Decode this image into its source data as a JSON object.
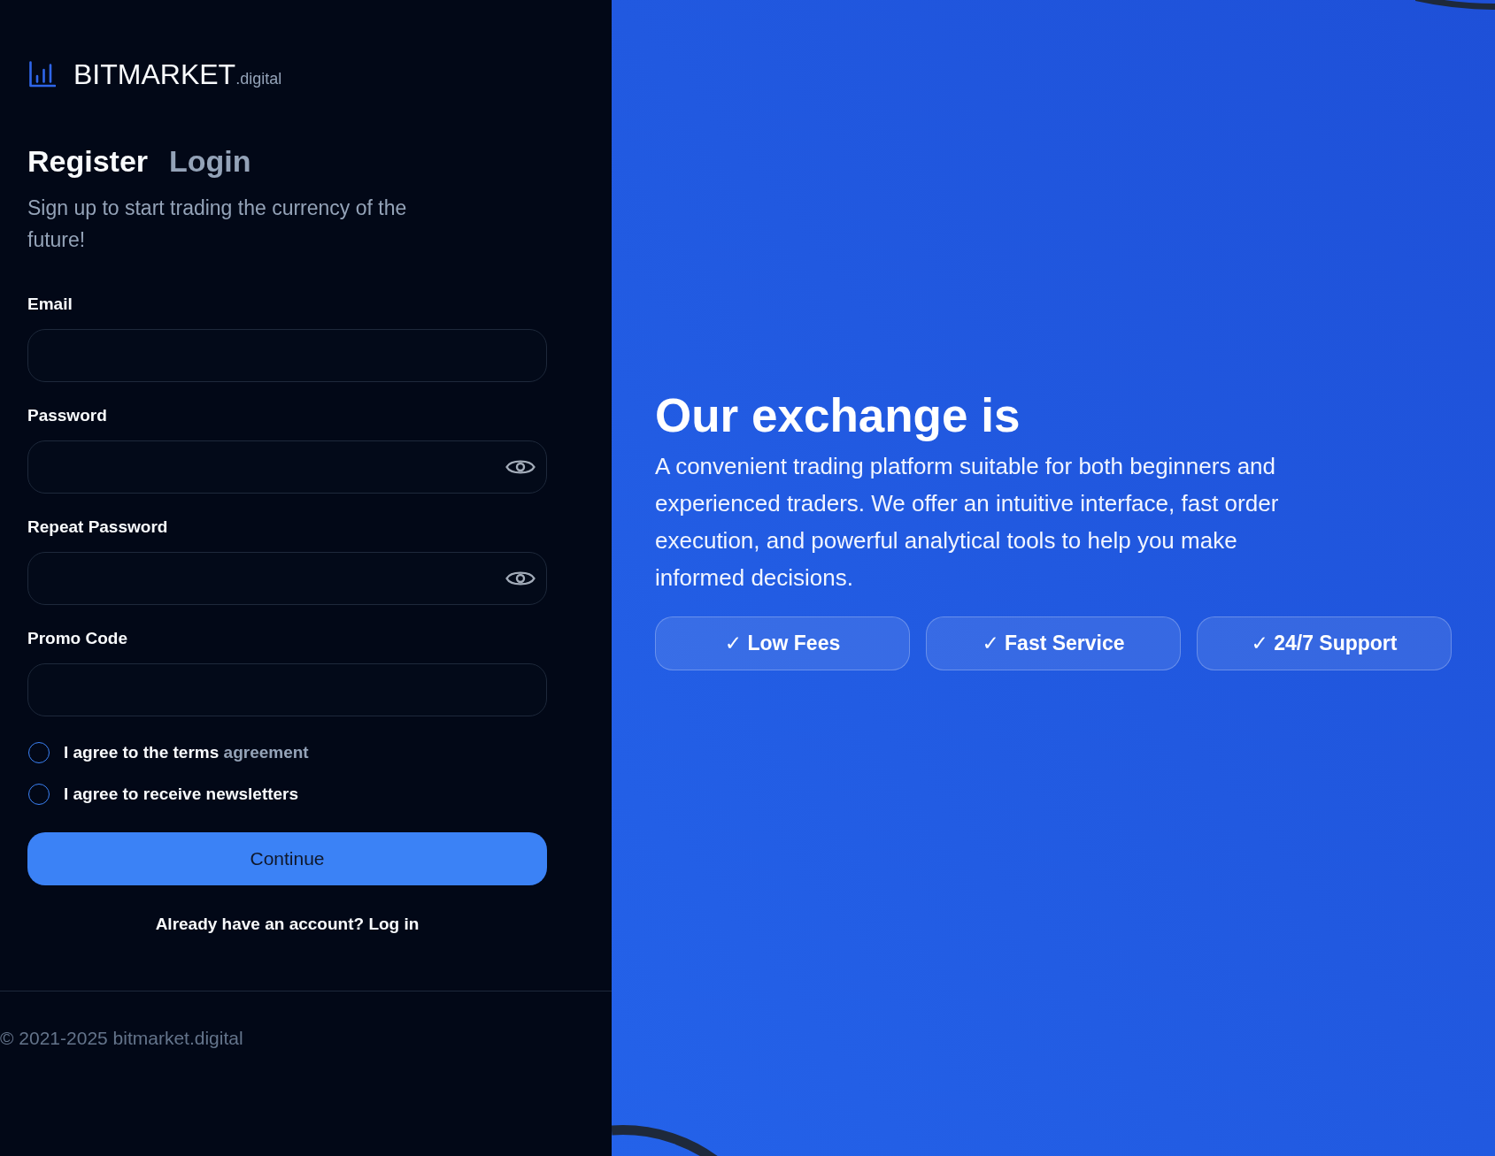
{
  "brand": {
    "name": "BITMARKET",
    "suffix": ".digital"
  },
  "tabs": [
    {
      "label": "Register",
      "selected": true
    },
    {
      "label": "Login",
      "selected": false
    }
  ],
  "subtitle": "Sign up to start trading the currency of the future!",
  "fields": [
    {
      "label": "Email",
      "kind": "text"
    },
    {
      "label": "Password",
      "kind": "password"
    },
    {
      "label": "Repeat Password",
      "kind": "password"
    },
    {
      "label": "Promo Code",
      "kind": "text"
    }
  ],
  "agreements": [
    {
      "label": "I agree to the terms",
      "link": "agreement",
      "checked": false
    },
    {
      "label": "I agree to receive newsletters",
      "checked": false
    }
  ],
  "submit": "Continue",
  "account_prompt": {
    "text": "Already have an account?",
    "link": "Log in"
  },
  "footer": "© 2021-2025 bitmarket.digital",
  "hero": {
    "title": "Our exchange is",
    "description": "A convenient trading platform suitable for both beginners and experienced traders. We offer an intuitive interface, fast order execution, and powerful analytical tools to help you make informed decisions.",
    "features": [
      "✓ Low Fees",
      "✓ Fast Service",
      "✓ 24/7 Support"
    ]
  }
}
